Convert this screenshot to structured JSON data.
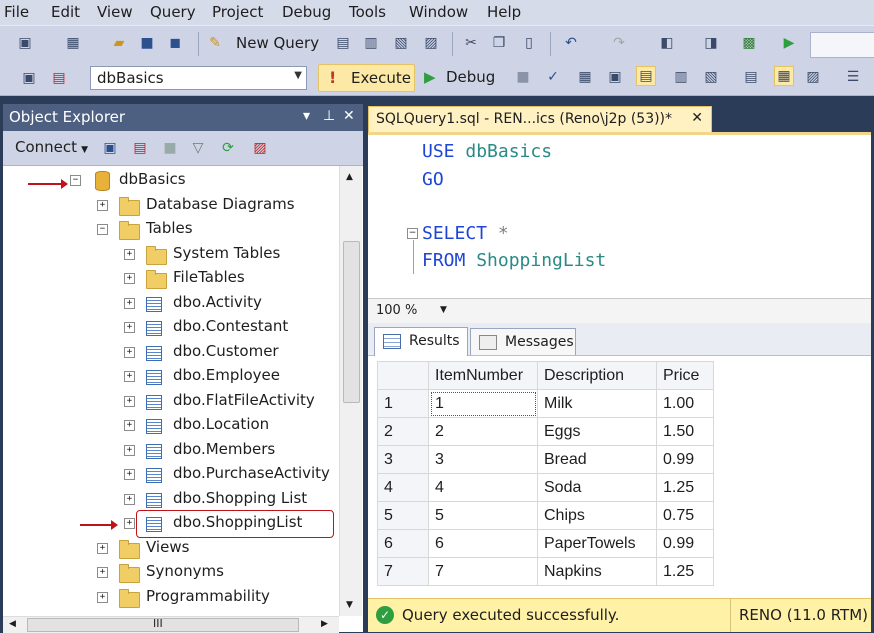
{
  "menu": [
    "File",
    "Edit",
    "View",
    "Query",
    "Project",
    "Debug",
    "Tools",
    "Window",
    "Help"
  ],
  "toolbar": {
    "new_query_label": "New Query",
    "database": "dbBasics",
    "execute_label": "Execute",
    "debug_label": "Debug"
  },
  "object_explorer": {
    "title": "Object Explorer",
    "connect_label": "Connect",
    "tree": [
      {
        "label": "dbBasics",
        "icon": "database-icon",
        "state": "-"
      },
      {
        "label": "Database Diagrams",
        "icon": "folder-icon",
        "state": "+"
      },
      {
        "label": "Tables",
        "icon": "folder-icon",
        "state": "-"
      },
      {
        "label": "System Tables",
        "icon": "folder-icon",
        "state": "+"
      },
      {
        "label": "FileTables",
        "icon": "folder-icon",
        "state": "+"
      },
      {
        "label": "dbo.Activity",
        "icon": "table-icon",
        "state": "+"
      },
      {
        "label": "dbo.Contestant",
        "icon": "table-icon",
        "state": "+"
      },
      {
        "label": "dbo.Customer",
        "icon": "table-icon",
        "state": "+"
      },
      {
        "label": "dbo.Employee",
        "icon": "table-icon",
        "state": "+"
      },
      {
        "label": "dbo.FlatFileActivity",
        "icon": "table-icon",
        "state": "+"
      },
      {
        "label": "dbo.Location",
        "icon": "table-icon",
        "state": "+"
      },
      {
        "label": "dbo.Members",
        "icon": "table-icon",
        "state": "+"
      },
      {
        "label": "dbo.PurchaseActivity",
        "icon": "table-icon",
        "state": "+"
      },
      {
        "label": "dbo.Shopping List",
        "icon": "table-icon",
        "state": "+"
      },
      {
        "label": "dbo.ShoppingList",
        "icon": "table-icon",
        "state": "+"
      },
      {
        "label": "Views",
        "icon": "folder-icon",
        "state": "+"
      },
      {
        "label": "Synonyms",
        "icon": "folder-icon",
        "state": "+"
      },
      {
        "label": "Programmability",
        "icon": "folder-icon",
        "state": "+"
      }
    ],
    "scroll_h_label": "III"
  },
  "editor": {
    "tab_title": "SQLQuery1.sql - REN...ics (Reno\\j2p (53))*",
    "lines": [
      {
        "kw": "USE",
        "rest": "dbBasics"
      },
      {
        "kw": "GO",
        "rest": ""
      },
      {
        "kw": "SELECT",
        "rest": "*"
      },
      {
        "kw": "FROM",
        "rest": "ShoppingList"
      }
    ],
    "zoom": "100 %"
  },
  "results": {
    "tabs": [
      "Results",
      "Messages"
    ],
    "columns": [
      "ItemNumber",
      "Description",
      "Price"
    ],
    "rows": [
      [
        "1",
        "1",
        "Milk",
        "1.00"
      ],
      [
        "2",
        "2",
        "Eggs",
        "1.50"
      ],
      [
        "3",
        "3",
        "Bread",
        "0.99"
      ],
      [
        "4",
        "4",
        "Soda",
        "1.25"
      ],
      [
        "5",
        "5",
        "Chips",
        "0.75"
      ],
      [
        "6",
        "6",
        "PaperTowels",
        "0.99"
      ],
      [
        "7",
        "7",
        "Napkins",
        "1.25"
      ]
    ]
  },
  "status": {
    "message": "Query executed successfully.",
    "server": "RENO (11.0 RTM)"
  },
  "colors": {
    "title_bar": "#4d6082",
    "status_bar": "#fff1a6",
    "highlight": "#c0121a"
  }
}
